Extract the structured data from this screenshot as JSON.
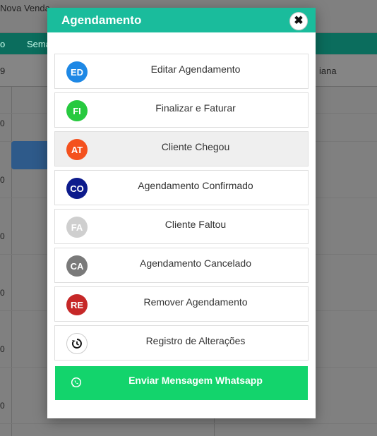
{
  "background": {
    "new_sale": "Nova Venda",
    "tabs": [
      "o",
      "Sema"
    ],
    "header_cells": [
      "9",
      "iana"
    ],
    "times": [
      "0",
      "0",
      "0",
      "0",
      "0",
      "0"
    ]
  },
  "modal": {
    "title": "Agendamento",
    "close_icon": "close-icon",
    "items": [
      {
        "badge": "ED",
        "label": "Editar Agendamento",
        "color": "#1e88e5"
      },
      {
        "badge": "FI",
        "label": "Finalizar e Faturar",
        "color": "#27c93f"
      },
      {
        "badge": "AT",
        "label": "Cliente Chegou",
        "color": "#f4511e"
      },
      {
        "badge": "CO",
        "label": "Agendamento Confirmado",
        "color": "#0d1b8c"
      },
      {
        "badge": "FA",
        "label": "Cliente Faltou",
        "color": "#cfcfcf"
      },
      {
        "badge": "CA",
        "label": "Agendamento Cancelado",
        "color": "#7a7a7a"
      },
      {
        "badge": "RE",
        "label": "Remover Agendamento",
        "color": "#c62828"
      },
      {
        "badge": "",
        "label": "Registro de Alterações",
        "icon": "history-icon"
      }
    ],
    "whatsapp": {
      "label": "Enviar Mensagem Whatsapp",
      "color": "#13d46c",
      "icon": "whatsapp-icon"
    }
  }
}
